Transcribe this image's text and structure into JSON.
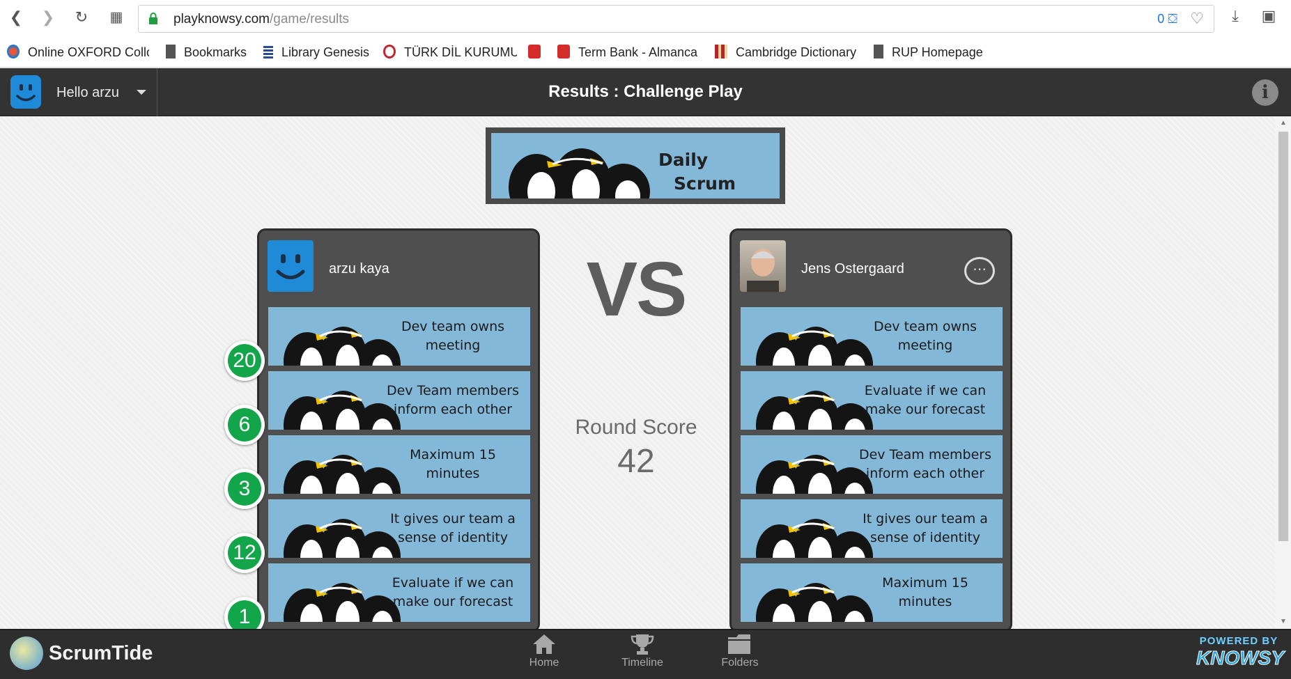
{
  "browser": {
    "url_domain": "playknowsy.com",
    "url_path": "/game/results",
    "shield_count": "0",
    "bookmarks": [
      {
        "label": "Online OXFORD Collo"
      },
      {
        "label": "Bookmarks"
      },
      {
        "label": "Library Genesis"
      },
      {
        "label": "TÜRK DİL KURUMU"
      },
      {
        "label": ""
      },
      {
        "label": "Term Bank - Almanca"
      },
      {
        "label": "Cambridge Dictionary"
      },
      {
        "label": "RUP Homepage"
      }
    ]
  },
  "header": {
    "greeting": "Hello arzu",
    "title": "Results : Challenge Play",
    "info_icon": "i"
  },
  "banner": {
    "line1": "Daily",
    "line2": "Scrum"
  },
  "players": [
    {
      "name": "arzu kaya",
      "cards": [
        {
          "line1": "Dev team owns",
          "line2": "meeting",
          "score": "20"
        },
        {
          "line1": "Dev Team members",
          "line2": "inform each other",
          "score": "6"
        },
        {
          "line1": "Maximum 15",
          "line2": "minutes",
          "score": "3"
        },
        {
          "line1": "It gives our team a",
          "line2": "sense of identity",
          "score": "12"
        },
        {
          "line1": "Evaluate if we can",
          "line2": "make our forecast",
          "score": "1"
        }
      ]
    },
    {
      "name": "Jens Ostergaard",
      "cards": [
        {
          "line1": "Dev team owns",
          "line2": "meeting"
        },
        {
          "line1": "Evaluate if we can",
          "line2": "make our forecast"
        },
        {
          "line1": "Dev Team members",
          "line2": "inform each other"
        },
        {
          "line1": "It gives our team a",
          "line2": "sense of identity"
        },
        {
          "line1": "Maximum 15",
          "line2": "minutes"
        }
      ]
    }
  ],
  "versus": "VS",
  "round": {
    "label": "Round Score",
    "score": "42"
  },
  "footer": {
    "brand": "ScrumTide",
    "nav": [
      {
        "label": "Home",
        "icon": "home-icon"
      },
      {
        "label": "Timeline",
        "icon": "trophy-icon"
      },
      {
        "label": "Folders",
        "icon": "folder-icon"
      }
    ],
    "powered_top": "POWERED BY",
    "powered_bottom": "KNOWSY"
  },
  "colors": {
    "card_blue": "#84b8d9",
    "score_green": "#12a54a",
    "header_dark": "#333333",
    "panel_gray": "#4f4f4f"
  }
}
